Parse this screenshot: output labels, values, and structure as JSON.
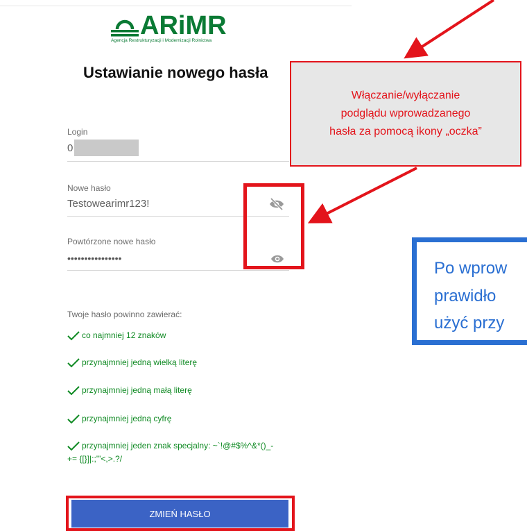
{
  "logo": {
    "text": "ARiMR",
    "subtitle": "Agencja Restrukturyzacji i Modernizacji Rolnictwa",
    "color": "#0a7a34"
  },
  "page_title": "Ustawianie nowego hasła",
  "form": {
    "login": {
      "label": "Login",
      "value": "0"
    },
    "new_password": {
      "label": "Nowe hasło",
      "value": "Testowearimr123!",
      "icon": "eye-off-icon"
    },
    "repeat_password": {
      "label": "Powtórzone nowe hasło",
      "value": "••••••••••••••••",
      "icon": "eye-icon"
    }
  },
  "requirements": {
    "title": "Twoje hasło powinno zawierać:",
    "items": [
      "co najmniej 12 znaków",
      "przynajmniej jedną wielką literę",
      "przynajmniej jedną małą literę",
      "przynajmniej jedną cyfrę",
      "przynajmniej jeden znak specjalny: ~`!@#$%^&*()_-",
      "+= {[}]|:;\"'<,>.?/"
    ],
    "color": "#0f8a23"
  },
  "submit_button": {
    "label": "ZMIEŃ HASŁO",
    "color": "#3b63c5"
  },
  "callout": {
    "lines": [
      "Włączanie/wyłączanie",
      "podglądu wprowadzanego",
      "hasła za pomocą ikony „oczka”"
    ],
    "color": "#e3141b"
  },
  "info_box": {
    "lines": [
      "Po wprow",
      "prawidło",
      "użyć przy"
    ],
    "color": "#2a6fd2"
  }
}
